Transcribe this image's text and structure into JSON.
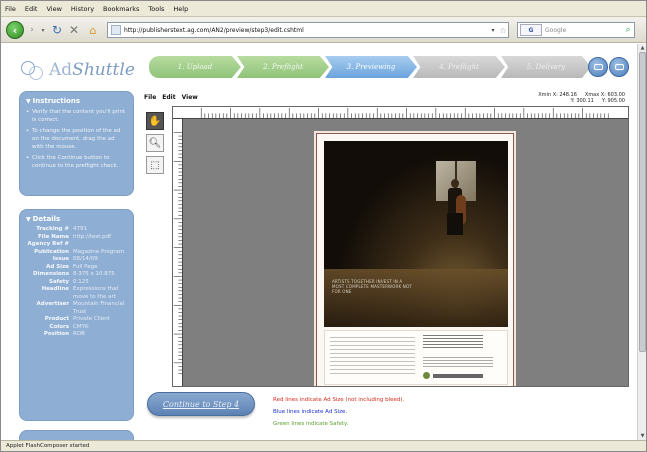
{
  "browser": {
    "menu": [
      "File",
      "Edit",
      "View",
      "History",
      "Bookmarks",
      "Tools",
      "Help"
    ],
    "url": "http://publisherstext.ag.com/AN2/preview/step3/edit.cshtml",
    "search_placeholder": "Google",
    "search_engine": "G",
    "status": "Applet FlashComposer started"
  },
  "logo": {
    "prefix": "Ad",
    "suffix": "Shuttle"
  },
  "steps": [
    {
      "label": "1. Upload",
      "state": "done"
    },
    {
      "label": "2. Preflight",
      "state": "done"
    },
    {
      "label": "3. Previewing",
      "state": "active"
    },
    {
      "label": "4. Preflight",
      "state": "todo"
    },
    {
      "label": "5. Delivery",
      "state": "todo"
    }
  ],
  "instructions": {
    "title": "Instructions",
    "items": [
      "Verify that the content you'll print is correct.",
      "To change the position of the ad on the document, drag the ad with the mouse.",
      "Click the Continue button to continue to the preflight check."
    ]
  },
  "details": {
    "title": "Details",
    "rows": [
      {
        "label": "Tracking #",
        "value": "4791"
      },
      {
        "label": "File Name",
        "value": "http://test.pdf"
      },
      {
        "label": "Agency Ref #",
        "value": ""
      },
      {
        "label": "Publication",
        "value": "Magazine Program"
      },
      {
        "label": "Issue",
        "value": "08/14/09"
      },
      {
        "label": "Ad Size",
        "value": "Full Page"
      },
      {
        "label": "Dimensions",
        "value": "8.375 x 10.875"
      },
      {
        "label": "Safety",
        "value": "0.125"
      },
      {
        "label": "Headline",
        "value": "Expressions that move to the art"
      },
      {
        "label": "Advertiser",
        "value": "Mountain Financial Trust"
      },
      {
        "label": "Product",
        "value": "Private Client"
      },
      {
        "label": "Colors",
        "value": "CMYK"
      },
      {
        "label": "Position",
        "value": "ROB"
      }
    ]
  },
  "editor": {
    "menu": [
      "File",
      "Edit",
      "View"
    ],
    "coords": {
      "x_label": "Xmin X: 248.16",
      "y_label": "Y: 300.11",
      "x2_label": "Xmax X: 603.00",
      "y2_label": "Y: 905.00"
    },
    "tools": [
      "hand-tool",
      "zoom-tool",
      "select-tool"
    ]
  },
  "ad": {
    "copy": "ARTISTS TOGETHER INVEST IN A MOST COMPLETE MASTERWORK NOT FOR ONE"
  },
  "continue_label": "Continue to Step 4",
  "legend": [
    {
      "text": "Red lines indicate Ad Size (not including bleed).",
      "color": "#d42a1a"
    },
    {
      "text": "Blue lines indicate Ad Size.",
      "color": "#1a2fd4"
    },
    {
      "text": "Green lines indicate Safety.",
      "color": "#5aa02c"
    }
  ],
  "colors": {
    "panel": "#8eaed3",
    "step_done": "#9dcc86",
    "step_active": "#7fb2e2",
    "step_todo": "#c4c4c4"
  }
}
